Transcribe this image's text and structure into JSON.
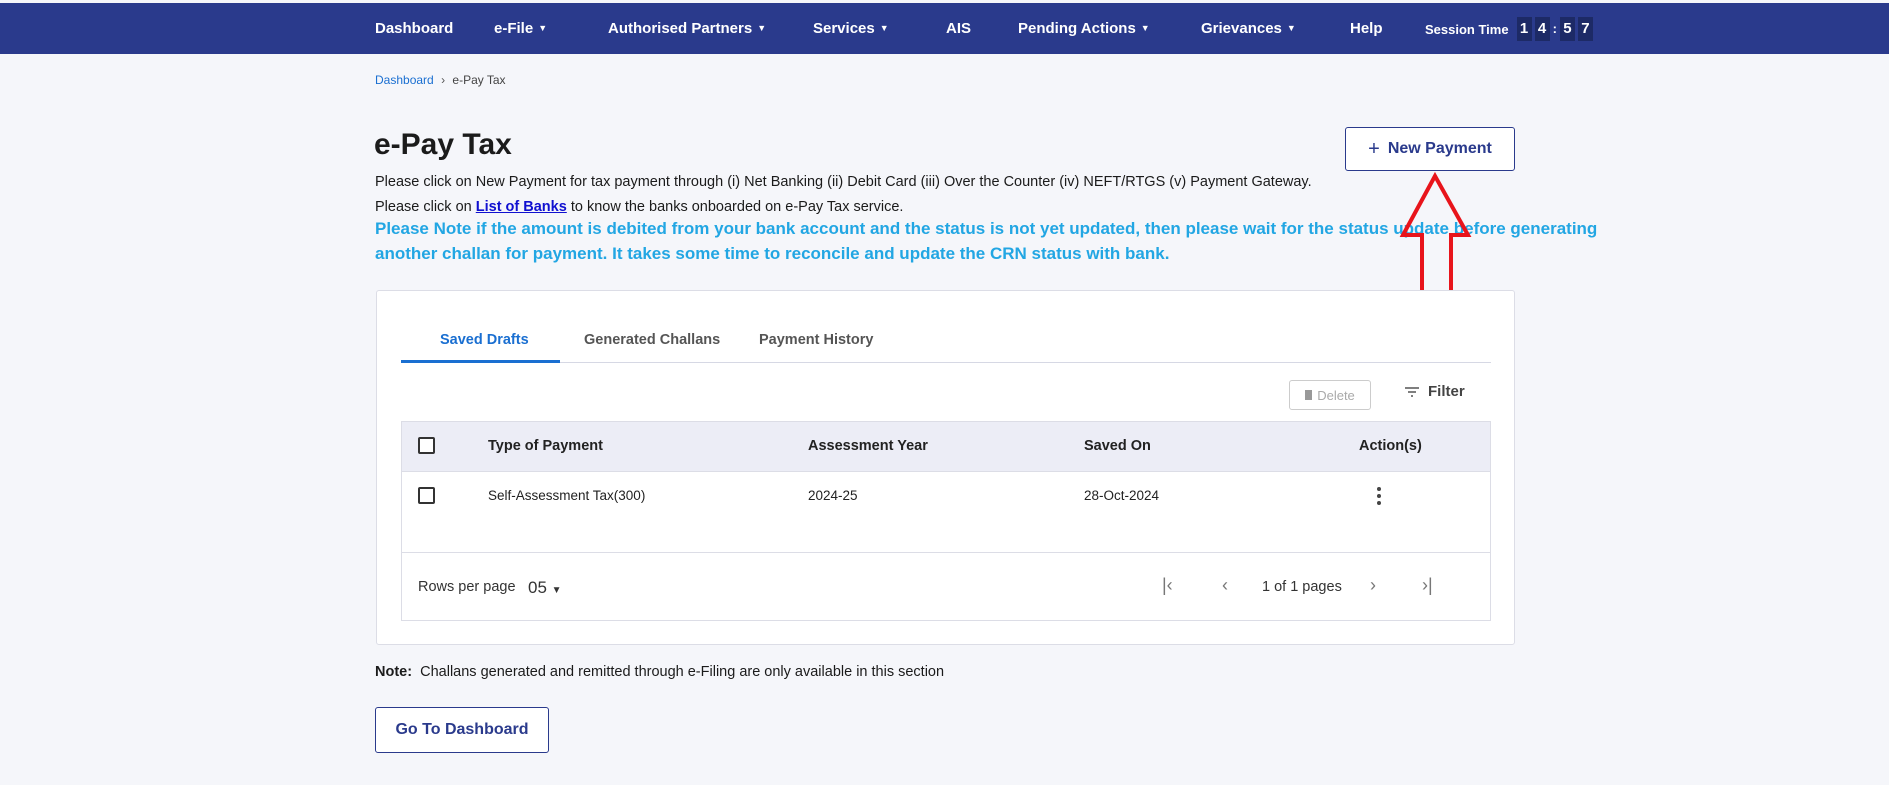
{
  "nav": {
    "items": [
      {
        "label": "Dashboard",
        "dropdown": false
      },
      {
        "label": "e-File",
        "dropdown": true
      },
      {
        "label": "Authorised Partners",
        "dropdown": true
      },
      {
        "label": "Services",
        "dropdown": true
      },
      {
        "label": "AIS",
        "dropdown": false
      },
      {
        "label": "Pending Actions",
        "dropdown": true
      },
      {
        "label": "Grievances",
        "dropdown": true
      },
      {
        "label": "Help",
        "dropdown": false
      }
    ],
    "session_label": "Session Time",
    "session_digits": [
      "1",
      "4",
      "5",
      "7"
    ],
    "session_sep": ":"
  },
  "breadcrumb": {
    "home": "Dashboard",
    "sep": "›",
    "current": "e-Pay Tax"
  },
  "page": {
    "title": "e-Pay Tax",
    "new_payment": "New Payment",
    "plus": "+",
    "line1": "Please click on New Payment for tax payment through (i) Net Banking (ii) Debit Card (iii) Over the Counter (iv) NEFT/RTGS (v) Payment Gateway.",
    "line2_pre": "Please click on ",
    "line2_link": "List of Banks",
    "line2_post": " to know the banks onboarded on e-Pay Tax service.",
    "note1": "Please Note if the amount is debited from your bank account and the status is not yet updated, then please wait for the status update before generating",
    "note2": "another challan for payment. It takes some time to reconcile and update the CRN status with bank."
  },
  "tabs": [
    "Saved Drafts",
    "Generated Challans",
    "Payment History"
  ],
  "toolbar": {
    "delete": "Delete",
    "filter": "Filter"
  },
  "table": {
    "headers": [
      "Type of Payment",
      "Assessment Year",
      "Saved On",
      "Action(s)"
    ],
    "rows": [
      {
        "type": "Self-Assessment Tax(300)",
        "ay": "2024-25",
        "saved_on": "28-Oct-2024"
      }
    ]
  },
  "pagination": {
    "rows_label": "Rows per page",
    "rows_value": "05",
    "page_text": "1 of 1 pages"
  },
  "footer": {
    "note_label": "Note:",
    "note_text": "Challans generated and remitted through e-Filing are only available in this section",
    "go_dashboard": "Go To Dashboard"
  },
  "colors": {
    "nav": "#2a3a8c",
    "accent": "#1a6fd1",
    "note": "#22a6e3",
    "annotation": "#e8141b"
  }
}
